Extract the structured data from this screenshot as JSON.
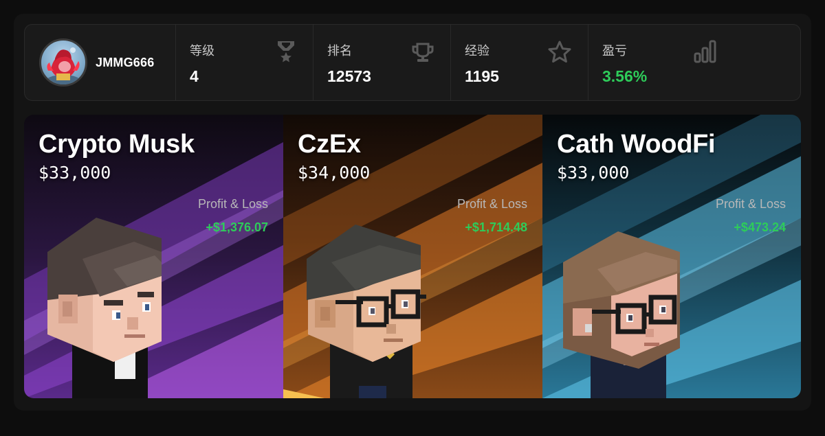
{
  "profile": {
    "username": "JMMG666"
  },
  "stats": [
    {
      "label": "等级",
      "value": "4",
      "icon": "medal-icon"
    },
    {
      "label": "排名",
      "value": "12573",
      "icon": "trophy-icon"
    },
    {
      "label": "经验",
      "value": "1195",
      "icon": "star-icon"
    },
    {
      "label": "盈亏",
      "value": "3.56%",
      "icon": "bar-chart-icon"
    }
  ],
  "cards": [
    {
      "name": "Crypto Musk",
      "price": "$33,000",
      "pnl_label": "Profit & Loss",
      "pnl_value": "+$1,376.07"
    },
    {
      "name": "CzEx",
      "price": "$34,000",
      "pnl_label": "Profit & Loss",
      "pnl_value": "+$1,714.48"
    },
    {
      "name": "Cath WoodFi",
      "price": "$33,000",
      "pnl_label": "Profit & Loss",
      "pnl_value": "+$473.24"
    }
  ],
  "colors": {
    "positive": "#2ecc5a",
    "card1_accent": "#9b45d6",
    "card2_accent": "#e8842a",
    "card3_accent": "#5ec3e8"
  }
}
